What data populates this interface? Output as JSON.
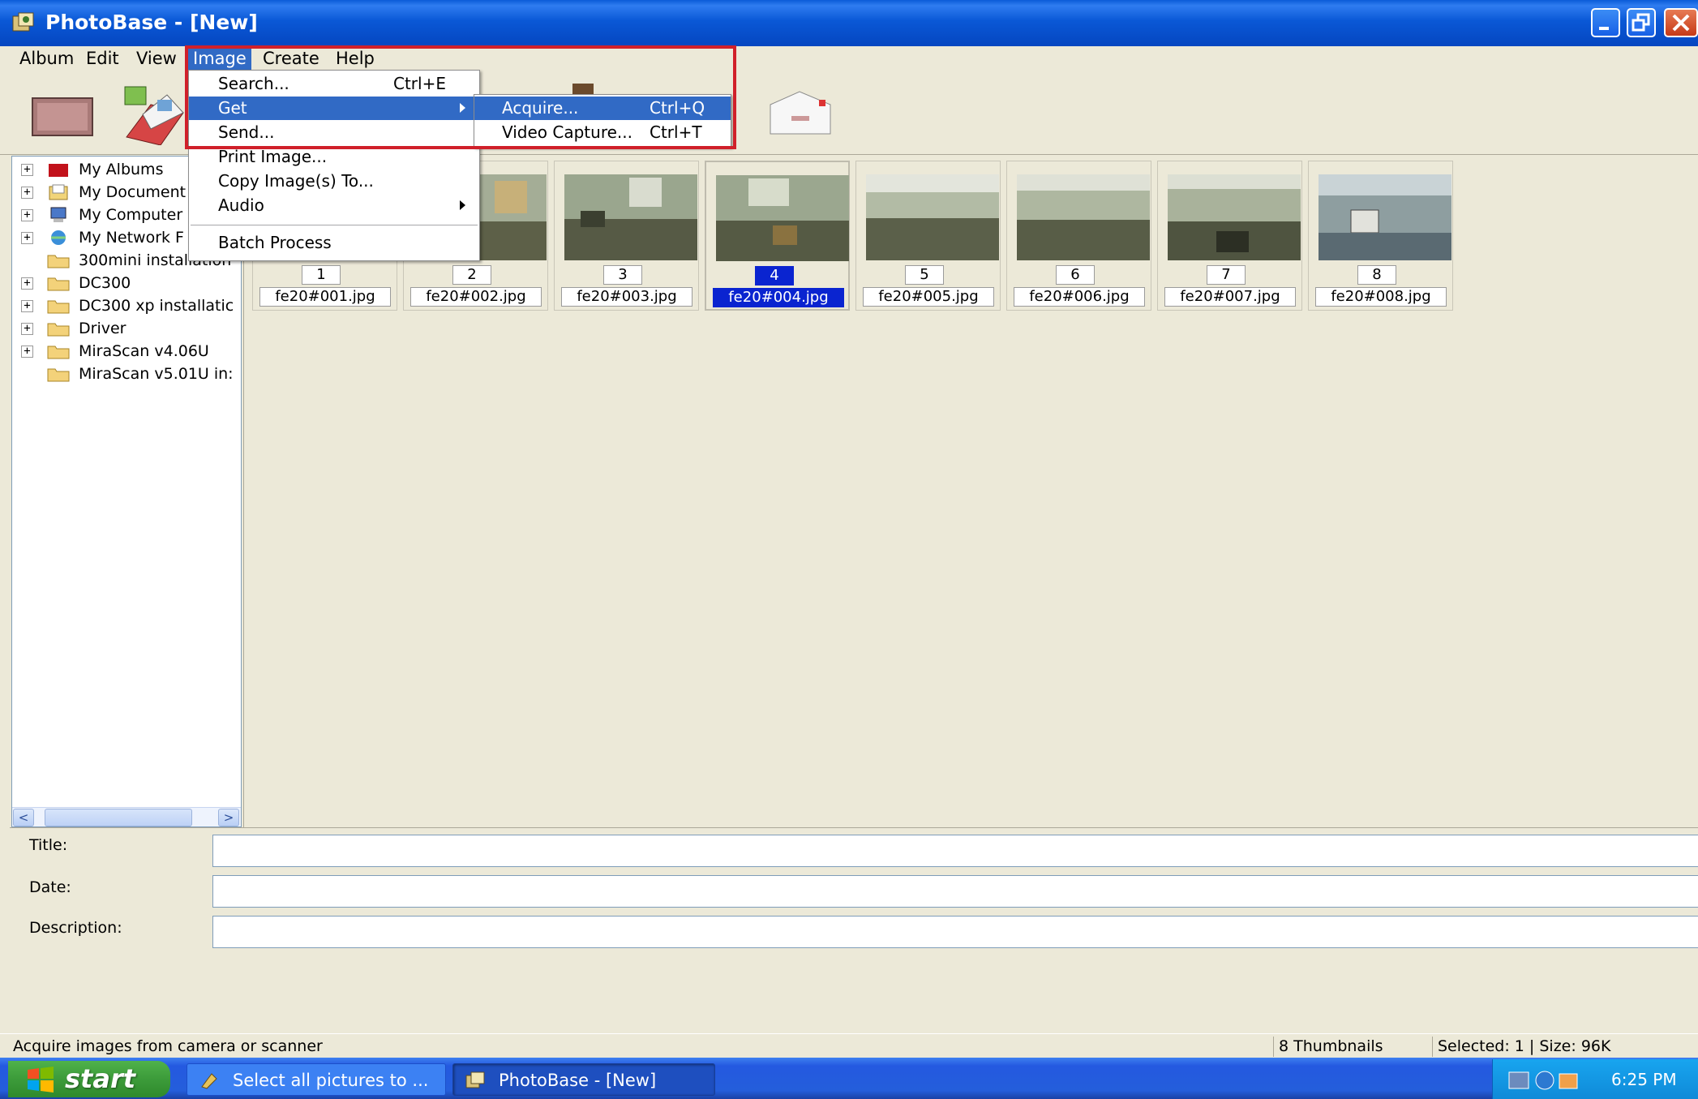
{
  "window": {
    "title": "PhotoBase - [New]"
  },
  "menubar": {
    "items": [
      "Album",
      "Edit",
      "View",
      "Image",
      "Create",
      "Help"
    ]
  },
  "image_menu": {
    "items": [
      {
        "label": "Search...",
        "shortcut": "Ctrl+E"
      },
      {
        "label": "Get",
        "submenu": true
      },
      {
        "label": "Send..."
      },
      {
        "label": "Print Image..."
      },
      {
        "label": "Copy Image(s) To..."
      },
      {
        "label": "Audio",
        "submenu": true
      },
      {
        "label": "Batch Process"
      }
    ]
  },
  "get_submenu": {
    "items": [
      {
        "label": "Acquire...",
        "shortcut": "Ctrl+Q"
      },
      {
        "label": "Video Capture...",
        "shortcut": "Ctrl+T"
      }
    ]
  },
  "tree": {
    "items": [
      {
        "label": "My Albums",
        "icon": "album-icon",
        "expandable": true
      },
      {
        "label": "My Document",
        "icon": "documents-icon",
        "expandable": true
      },
      {
        "label": "My Computer",
        "icon": "computer-icon",
        "expandable": true
      },
      {
        "label": "My Network F",
        "icon": "network-icon",
        "expandable": true
      },
      {
        "label": "300mini installation",
        "icon": "folder-icon",
        "expandable": false
      },
      {
        "label": "DC300",
        "icon": "folder-icon",
        "expandable": true
      },
      {
        "label": "DC300 xp installatic",
        "icon": "folder-icon",
        "expandable": true
      },
      {
        "label": "Driver",
        "icon": "folder-icon",
        "expandable": true
      },
      {
        "label": "MiraScan v4.06U",
        "icon": "folder-icon",
        "expandable": true
      },
      {
        "label": "MiraScan v5.01U in:",
        "icon": "folder-icon",
        "expandable": false
      }
    ]
  },
  "thumbnails": [
    {
      "number": "1",
      "filename": "fe20#001.jpg",
      "selected": false
    },
    {
      "number": "2",
      "filename": "fe20#002.jpg",
      "selected": false
    },
    {
      "number": "3",
      "filename": "fe20#003.jpg",
      "selected": false
    },
    {
      "number": "4",
      "filename": "fe20#004.jpg",
      "selected": true
    },
    {
      "number": "5",
      "filename": "fe20#005.jpg",
      "selected": false
    },
    {
      "number": "6",
      "filename": "fe20#006.jpg",
      "selected": false
    },
    {
      "number": "7",
      "filename": "fe20#007.jpg",
      "selected": false
    },
    {
      "number": "8",
      "filename": "fe20#008.jpg",
      "selected": false
    }
  ],
  "fields": {
    "title_label": "Title:",
    "date_label": "Date:",
    "description_label": "Description:",
    "title_value": "",
    "date_value": "",
    "description_value": ""
  },
  "statusbar": {
    "message": "Acquire images from camera or scanner",
    "thumbnail_count": "8 Thumbnails",
    "selection": "Selected: 1  |  Size: 96K"
  },
  "taskbar": {
    "start_label": "start",
    "buttons": [
      {
        "label": "Select all pictures to ...",
        "active": false
      },
      {
        "label": "PhotoBase - [New]",
        "active": true
      }
    ],
    "clock": "6:25 PM"
  },
  "colors": {
    "highlight": "#316ac5",
    "selection": "#0a24d0",
    "annotation_box": "#d0202a"
  }
}
